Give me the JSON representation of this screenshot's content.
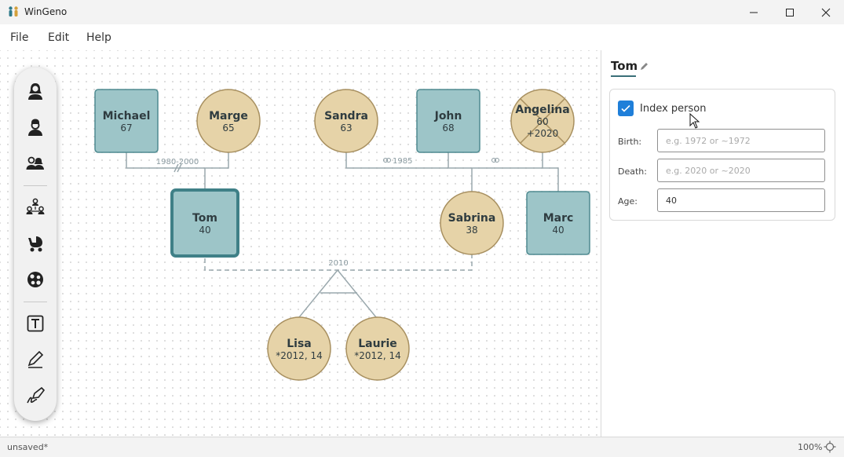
{
  "app": {
    "title": "WinGeno"
  },
  "menu": {
    "items": [
      "File",
      "Edit",
      "Help"
    ]
  },
  "toolbar": {
    "tools": [
      {
        "name": "add-female-icon"
      },
      {
        "name": "add-male-icon"
      },
      {
        "name": "add-couple-icon"
      },
      {
        "name": "add-family-icon"
      },
      {
        "name": "add-child-icon"
      },
      {
        "name": "add-group-icon"
      },
      {
        "name": "text-tool-icon"
      },
      {
        "name": "pen-tool-icon"
      },
      {
        "name": "signature-tool-icon"
      }
    ]
  },
  "tree": {
    "persons": {
      "michael": {
        "name": "Michael",
        "sub": "67",
        "shape": "square"
      },
      "marge": {
        "name": "Marge",
        "sub": "65",
        "shape": "circle"
      },
      "sandra": {
        "name": "Sandra",
        "sub": "63",
        "shape": "circle"
      },
      "john": {
        "name": "John",
        "sub": "68",
        "shape": "square"
      },
      "angelina": {
        "name": "Angelina",
        "sub": "60",
        "sub2": "+2020",
        "shape": "circle",
        "deceased": true
      },
      "tom": {
        "name": "Tom",
        "sub": "40",
        "shape": "square",
        "index": true
      },
      "sabrina": {
        "name": "Sabrina",
        "sub": "38",
        "shape": "circle"
      },
      "marc": {
        "name": "Marc",
        "sub": "40",
        "shape": "square"
      },
      "lisa": {
        "name": "Lisa",
        "sub": "*2012, 14",
        "shape": "circle"
      },
      "laurie": {
        "name": "Laurie",
        "sub": "*2012, 14",
        "shape": "circle"
      }
    },
    "unions": {
      "michael_marge": "1980-2000",
      "sandra_john": "1985",
      "tom_sabrina": "2010"
    }
  },
  "panel": {
    "title": "Tom",
    "index_person": {
      "label": "Index person",
      "checked": true
    },
    "birth": {
      "label": "Birth:",
      "placeholder": "e.g. 1972 or ~1972",
      "value": ""
    },
    "death": {
      "label": "Death:",
      "placeholder": "e.g. 2020 or ~2020",
      "value": ""
    },
    "age": {
      "label": "Age:",
      "value": "40"
    }
  },
  "status": {
    "text": "unsaved*",
    "zoom": "100%"
  },
  "colors": {
    "male_fill": "#9dc5c8",
    "male_stroke": "#4e8a90",
    "female_fill": "#e6d3a8",
    "female_stroke": "#a89060",
    "line": "#9aa8ad",
    "accent": "#1f7fd9",
    "index_border": "#3f8087"
  }
}
